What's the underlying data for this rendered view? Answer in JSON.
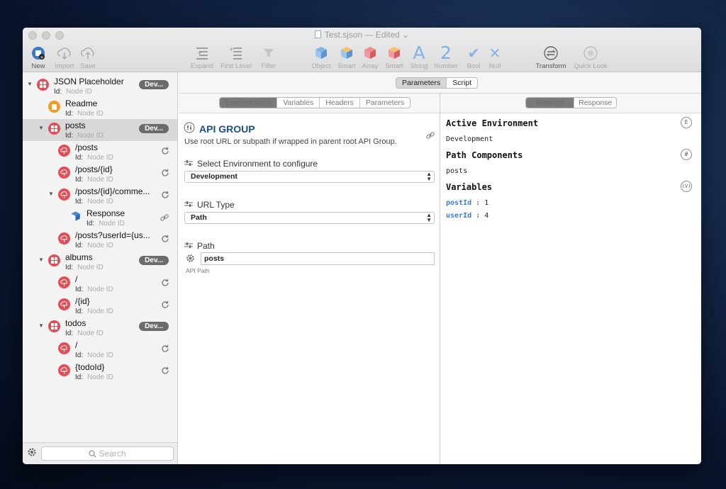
{
  "window": {
    "title": "Test.sjson",
    "title_suffix": "— Edited",
    "title_chevron": "⌄"
  },
  "toolbar": {
    "buttons": [
      {
        "label": "New",
        "icon": "new-document-icon"
      },
      {
        "label": "Import",
        "icon": "cloud-download-icon"
      },
      {
        "label": "Save",
        "icon": "cloud-upload-icon"
      },
      {
        "label": "Expand",
        "icon": "expand-icon"
      },
      {
        "label": "First Level",
        "icon": "first-level-icon"
      },
      {
        "label": "Filter",
        "icon": "filter-icon"
      },
      {
        "label": "Object",
        "icon": "object-cube-icon"
      },
      {
        "label": "Smart",
        "icon": "smart-cube-icon"
      },
      {
        "label": "Array",
        "icon": "array-cube-icon"
      },
      {
        "label": "Smart",
        "icon": "smart-array-cube-icon"
      },
      {
        "label": "String",
        "icon": "string-a-icon",
        "glyph": "A"
      },
      {
        "label": "Number",
        "icon": "number-2-icon",
        "glyph": "2"
      },
      {
        "label": "Bool",
        "icon": "checkmark-icon",
        "glyph": "✔"
      },
      {
        "label": "Null",
        "icon": "x-icon",
        "glyph": "✕"
      },
      {
        "label": "Transform",
        "icon": "transform-icon"
      },
      {
        "label": "Quick Look",
        "icon": "eye-icon"
      }
    ]
  },
  "sidebar": {
    "id_label": "Id:",
    "id_placeholder": "Node ID",
    "badge": "Dev...",
    "search_placeholder": "Search",
    "items": [
      {
        "name": "JSON Placeholder",
        "level": 0,
        "icon": "red",
        "expanded": true,
        "badge": true,
        "refresh": false,
        "selected": false
      },
      {
        "name": "Readme",
        "level": 1,
        "icon": "orange",
        "expanded": null,
        "badge": false,
        "refresh": false,
        "selected": false
      },
      {
        "name": "posts",
        "level": 1,
        "icon": "red",
        "expanded": true,
        "badge": true,
        "refresh": false,
        "selected": true
      },
      {
        "name": "/posts",
        "level": 2,
        "icon": "red-cloud",
        "expanded": null,
        "badge": false,
        "refresh": true,
        "selected": false
      },
      {
        "name": "/posts/{id}",
        "level": 2,
        "icon": "red-cloud",
        "expanded": null,
        "badge": false,
        "refresh": true,
        "selected": false
      },
      {
        "name": "/posts/{id}/comme...",
        "level": 2,
        "icon": "red-cloud",
        "expanded": true,
        "badge": false,
        "refresh": true,
        "selected": false
      },
      {
        "name": "Response",
        "level": 3,
        "icon": "blue",
        "expanded": null,
        "badge": false,
        "refresh": false,
        "link": true,
        "selected": false
      },
      {
        "name": "/posts?userId={us...",
        "level": 2,
        "icon": "red-cloud",
        "expanded": null,
        "badge": false,
        "refresh": true,
        "selected": false
      },
      {
        "name": "albums",
        "level": 1,
        "icon": "red",
        "expanded": true,
        "badge": true,
        "refresh": false,
        "selected": false
      },
      {
        "name": "/",
        "level": 2,
        "icon": "red-cloud",
        "expanded": null,
        "badge": false,
        "refresh": true,
        "selected": false
      },
      {
        "name": "/{id}",
        "level": 2,
        "icon": "red-cloud",
        "expanded": null,
        "badge": false,
        "refresh": true,
        "selected": false
      },
      {
        "name": "todos",
        "level": 1,
        "icon": "red",
        "expanded": true,
        "badge": true,
        "refresh": false,
        "selected": false
      },
      {
        "name": "/",
        "level": 2,
        "icon": "red-cloud",
        "expanded": null,
        "badge": false,
        "refresh": true,
        "selected": false
      },
      {
        "name": "{todoId}",
        "level": 2,
        "icon": "red-cloud",
        "expanded": null,
        "badge": false,
        "refresh": true,
        "selected": false
      }
    ]
  },
  "main": {
    "top_tabs": [
      "Parameters",
      "Script"
    ],
    "top_tab_selected": "Parameters",
    "left_tabs": [
      "Environments",
      "Variables",
      "Headers",
      "Parameters"
    ],
    "right_tabs": [
      "Request",
      "Response"
    ],
    "group_title": "API GROUP",
    "group_desc": "Use root URL or subpath if wrapped in parent root API Group.",
    "env_label": "Select Environment to configure",
    "env_value": "Development",
    "url_type_label": "URL Type",
    "url_type_value": "Path",
    "path_label": "Path",
    "path_value": "posts",
    "path_caption": "API Path"
  },
  "request": {
    "active_env_heading": "Active Environment",
    "active_env_value": "Development",
    "active_env_badge": "E",
    "path_heading": "Path Components",
    "path_value": "posts",
    "path_badge": "#",
    "vars_heading": "Variables",
    "vars_badge": "(V)",
    "vars": [
      {
        "key": "postId",
        "sep": ":",
        "value": "1"
      },
      {
        "key": "userId",
        "sep": ":",
        "value": "4"
      }
    ]
  },
  "colors": {
    "accent_blue": "#1a4f8a",
    "node_red": "#e44d55",
    "node_orange": "#f29b1f",
    "var_key": "#3a7bd5"
  }
}
